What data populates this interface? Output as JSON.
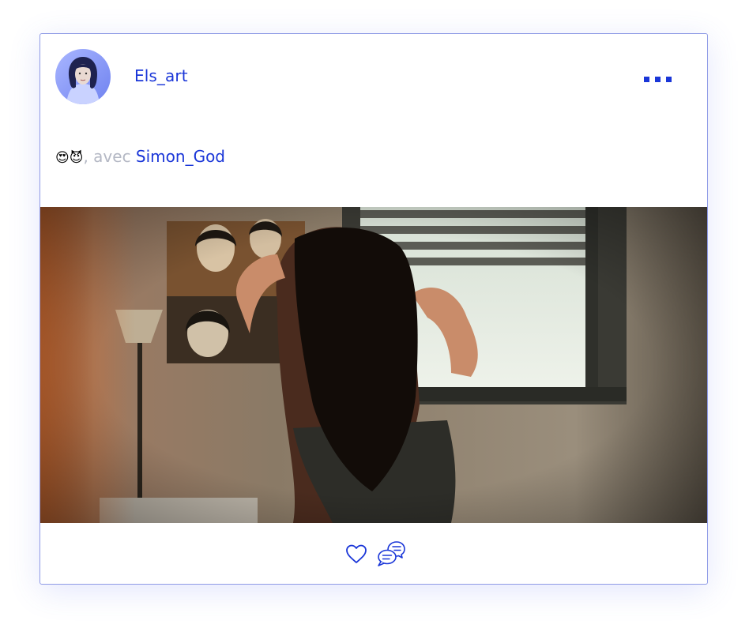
{
  "post": {
    "username": "Els_art",
    "caption": {
      "emojis": "😍😈",
      "with_text": ", avec ",
      "tagged_user": "Simon_God"
    }
  },
  "icons": {
    "avatar": "avatar",
    "more": "more-dots-icon",
    "like": "heart-icon",
    "comment": "chat-bubbles-icon"
  },
  "colors": {
    "accent": "#1a36d8",
    "border": "#8f9be6",
    "muted_text": "#b4b8c4"
  }
}
